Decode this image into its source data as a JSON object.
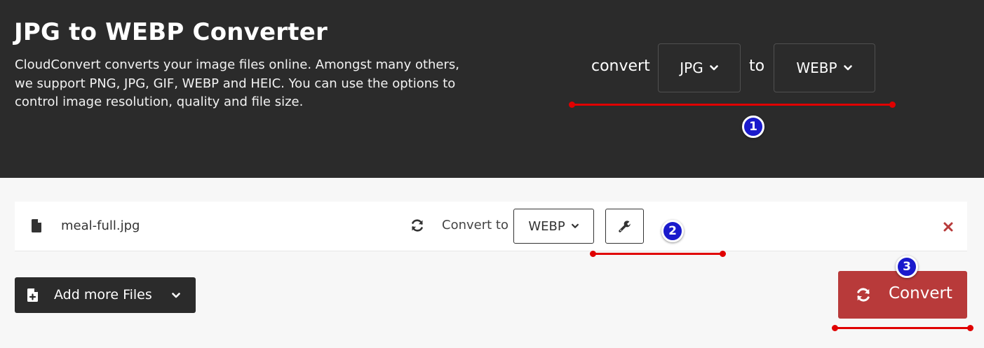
{
  "hero": {
    "title": "JPG to WEBP Converter",
    "description": "CloudConvert converts your image files online. Amongst many others, we support PNG, JPG, GIF, WEBP and HEIC. You can use the options to control image resolution, quality and file size.",
    "convert_word": "convert",
    "to_word": "to",
    "from_format": "JPG",
    "to_format": "WEBP"
  },
  "file_row": {
    "file_name": "meal-full.jpg",
    "convert_to_label": "Convert to",
    "target_format": "WEBP"
  },
  "actions": {
    "add_files_label": "Add more Files",
    "convert_label": "Convert"
  },
  "annotations": [
    "1",
    "2",
    "3"
  ],
  "colors": {
    "hero_bg": "#2b2b2b",
    "convert_bg": "#b83a3a",
    "annotation_red": "#e00000",
    "badge_blue": "#1a1acc"
  },
  "icons": [
    "file-icon",
    "sync-icon",
    "wrench-icon",
    "close-icon",
    "file-plus-icon",
    "chevron-down-icon"
  ]
}
